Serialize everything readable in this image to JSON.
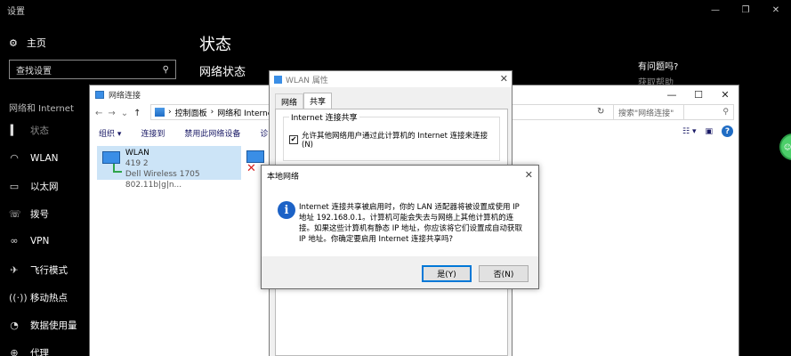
{
  "settings": {
    "window_title": "设置",
    "home_label": "主页",
    "search_placeholder": "查找设置",
    "section_label": "网络和 Internet",
    "nav": [
      {
        "icon": "status-icon",
        "label": "状态"
      },
      {
        "icon": "wifi-icon",
        "label": "WLAN"
      },
      {
        "icon": "ethernet-icon",
        "label": "以太网"
      },
      {
        "icon": "dialup-icon",
        "label": "拨号"
      },
      {
        "icon": "vpn-icon",
        "label": "VPN"
      },
      {
        "icon": "airplane-icon",
        "label": "飞行模式"
      },
      {
        "icon": "hotspot-icon",
        "label": "移动热点"
      },
      {
        "icon": "data-usage-icon",
        "label": "数据使用量"
      },
      {
        "icon": "proxy-icon",
        "label": "代理"
      }
    ],
    "page_title": "状态",
    "page_subtitle": "网络状态",
    "help_title": "有问题吗?",
    "help_link": "获取帮助"
  },
  "netconn": {
    "window_title": "网络连接",
    "breadcrumb": [
      "控制面板",
      "网络和 Internet"
    ],
    "search_placeholder": "搜索\"网络连接\"",
    "toolbar": [
      "组织 ▾",
      "连接到",
      "禁用此网络设备",
      "诊断这"
    ],
    "adapters": [
      {
        "name": "WLAN",
        "status": "419  2",
        "device": "Dell Wireless 1705 802.11b|g|n..."
      }
    ]
  },
  "wlan_properties": {
    "window_title": "WLAN 属性",
    "tabs": [
      "网络",
      "共享"
    ],
    "active_tab": "共享",
    "group_label": "Internet 连接共享",
    "checkbox_label": "允许其他网络用户通过此计算机的 Internet 连接来连接(N)",
    "checkbox_checked": true
  },
  "message_box": {
    "title": "本地网络",
    "message": "Internet 连接共享被启用时，你的 LAN 适配器将被设置成使用 IP 地址 192.168.0.1。计算机可能会失去与网络上其他计算机的连接。如果这些计算机有静态 IP 地址，你应该将它们设置成自动获取 IP 地址。你确定要启用 Internet 连接共享吗?",
    "yes_label": "是(Y)",
    "no_label": "否(N)"
  },
  "colors": {
    "accent": "#0078d7",
    "selection": "#cce4f7",
    "info_icon": "#1c62c6"
  }
}
